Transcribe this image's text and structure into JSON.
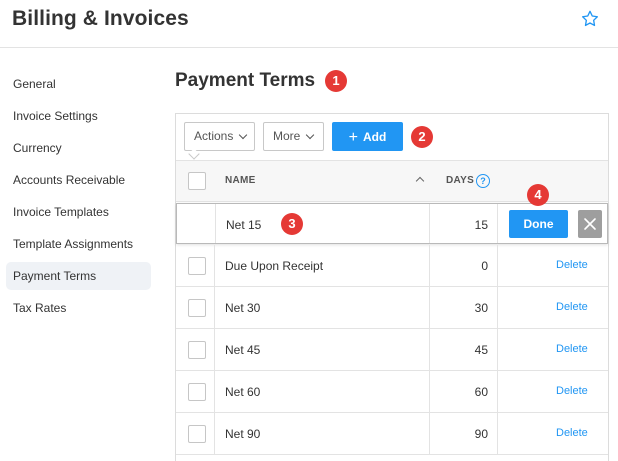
{
  "header": {
    "title": "Billing & Invoices",
    "favorite_icon": "star-outline-icon"
  },
  "sidebar": {
    "items": [
      {
        "label": "General"
      },
      {
        "label": "Invoice Settings"
      },
      {
        "label": "Currency"
      },
      {
        "label": "Accounts Receivable"
      },
      {
        "label": "Invoice Templates"
      },
      {
        "label": "Template Assignments"
      },
      {
        "label": "Payment Terms",
        "active": true
      },
      {
        "label": "Tax Rates"
      }
    ]
  },
  "main": {
    "title": "Payment Terms",
    "toolbar": {
      "actions_label": "Actions",
      "more_label": "More",
      "add_label": "Add"
    },
    "table": {
      "columns": {
        "name": "NAME",
        "days": "DAYS"
      },
      "editing_row": {
        "name": "Net 15",
        "days": "15",
        "done_label": "Done"
      },
      "rows": [
        {
          "name": "Due Upon Receipt",
          "days": "0",
          "action": "Delete"
        },
        {
          "name": "Net 30",
          "days": "30",
          "action": "Delete"
        },
        {
          "name": "Net 45",
          "days": "45",
          "action": "Delete"
        },
        {
          "name": "Net 60",
          "days": "60",
          "action": "Delete"
        },
        {
          "name": "Net 90",
          "days": "90",
          "action": "Delete"
        }
      ]
    }
  },
  "annotations": {
    "badge_1": "1",
    "badge_2": "2",
    "badge_3": "3",
    "badge_4": "4"
  },
  "colors": {
    "accent": "#2196f3",
    "badge": "#e53935",
    "active_nav_bg": "#eff2f6",
    "cancel_bg": "#9e9e9e"
  }
}
